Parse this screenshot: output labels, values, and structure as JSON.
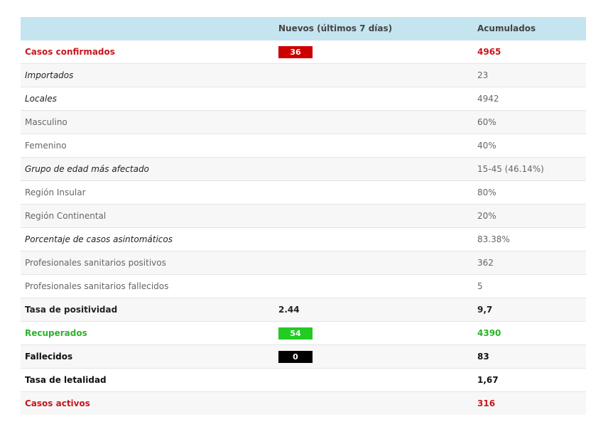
{
  "header": {
    "col1": "",
    "col2": "Nuevos (últimos 7 días)",
    "col3": "Acumulados"
  },
  "colors": {
    "header_bg": "#c4e4ef",
    "red": "#c8171e",
    "green": "#2bb32b",
    "black": "#000000"
  },
  "rows": [
    {
      "label": "Casos confirmados",
      "nuevo": "36",
      "acumulado": "4965"
    },
    {
      "label": "Importados",
      "nuevo": "",
      "acumulado": "23"
    },
    {
      "label": "Locales",
      "nuevo": "",
      "acumulado": "4942"
    },
    {
      "label": "Masculino",
      "nuevo": "",
      "acumulado": "60%"
    },
    {
      "label": "Femenino",
      "nuevo": "",
      "acumulado": "40%"
    },
    {
      "label": "Grupo de edad más afectado",
      "nuevo": "",
      "acumulado": "15-45 (46.14%)"
    },
    {
      "label": "Región Insular",
      "nuevo": "",
      "acumulado": "80%"
    },
    {
      "label": "Región Continental",
      "nuevo": "",
      "acumulado": "20%"
    },
    {
      "label": "Porcentaje de casos asintomáticos",
      "nuevo": "",
      "acumulado": "83.38%"
    },
    {
      "label": "Profesionales sanitarios positivos",
      "nuevo": "",
      "acumulado": "362"
    },
    {
      "label": "Profesionales sanitarios fallecidos",
      "nuevo": "",
      "acumulado": "5"
    },
    {
      "label": "Tasa de positividad",
      "nuevo": "2.44",
      "acumulado": "9,7"
    },
    {
      "label": "Recuperados",
      "nuevo": "54",
      "acumulado": "4390"
    },
    {
      "label": "Fallecidos",
      "nuevo": "0",
      "acumulado": "83"
    },
    {
      "label": "Tasa de letalidad",
      "nuevo": "",
      "acumulado": "1,67"
    },
    {
      "label": "Casos activos",
      "nuevo": "",
      "acumulado": "316"
    }
  ]
}
